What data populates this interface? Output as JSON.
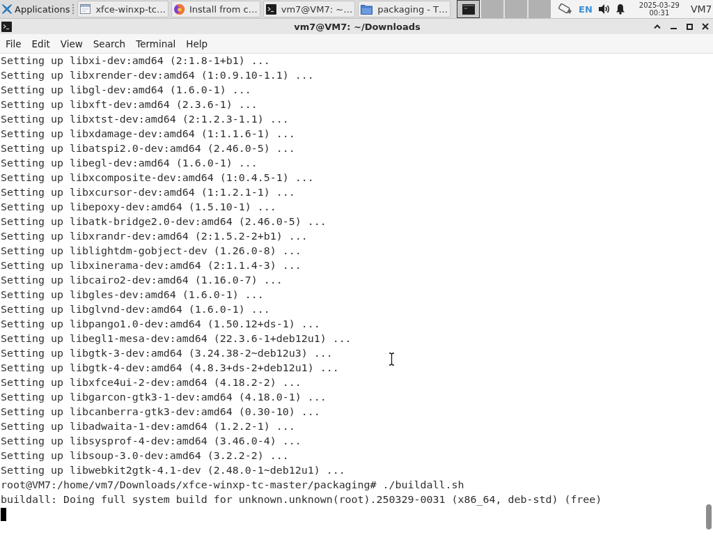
{
  "panel": {
    "applications_menu": {
      "label": "Applications"
    },
    "tasks": [
      {
        "kind": "window",
        "label": "xfce-winxp-tc…"
      },
      {
        "kind": "browser",
        "label": "Install from c…"
      },
      {
        "kind": "terminal",
        "label": "vm7@VM7: ~…"
      },
      {
        "kind": "folder",
        "label": "packaging - T…"
      }
    ],
    "workspaces": [
      {
        "selected": true,
        "window_preview": true
      },
      {
        "selected": false,
        "window_preview": false
      },
      {
        "selected": false,
        "window_preview": false
      },
      {
        "selected": false,
        "window_preview": false
      }
    ],
    "tray": {
      "keyboard_layout": "EN",
      "clock_date": "2025-03-29",
      "clock_time": "00:31",
      "user": "VM7"
    }
  },
  "window": {
    "title": "vm7@VM7: ~/Downloads"
  },
  "menu_bar": [
    "File",
    "Edit",
    "View",
    "Search",
    "Terminal",
    "Help"
  ],
  "terminal": {
    "lines": [
      "Setting up libxi-dev:amd64 (2:1.8-1+b1) ...",
      "Setting up libxrender-dev:amd64 (1:0.9.10-1.1) ...",
      "Setting up libgl-dev:amd64 (1.6.0-1) ...",
      "Setting up libxft-dev:amd64 (2.3.6-1) ...",
      "Setting up libxtst-dev:amd64 (2:1.2.3-1.1) ...",
      "Setting up libxdamage-dev:amd64 (1:1.1.6-1) ...",
      "Setting up libatspi2.0-dev:amd64 (2.46.0-5) ...",
      "Setting up libegl-dev:amd64 (1.6.0-1) ...",
      "Setting up libxcomposite-dev:amd64 (1:0.4.5-1) ...",
      "Setting up libxcursor-dev:amd64 (1:1.2.1-1) ...",
      "Setting up libepoxy-dev:amd64 (1.5.10-1) ...",
      "Setting up libatk-bridge2.0-dev:amd64 (2.46.0-5) ...",
      "Setting up libxrandr-dev:amd64 (2:1.5.2-2+b1) ...",
      "Setting up liblightdm-gobject-dev (1.26.0-8) ...",
      "Setting up libxinerama-dev:amd64 (2:1.1.4-3) ...",
      "Setting up libcairo2-dev:amd64 (1.16.0-7) ...",
      "Setting up libgles-dev:amd64 (1.6.0-1) ...",
      "Setting up libglvnd-dev:amd64 (1.6.0-1) ...",
      "Setting up libpango1.0-dev:amd64 (1.50.12+ds-1) ...",
      "Setting up libegl1-mesa-dev:amd64 (22.3.6-1+deb12u1) ...",
      "Setting up libgtk-3-dev:amd64 (3.24.38-2~deb12u3) ...",
      "Setting up libgtk-4-dev:amd64 (4.8.3+ds-2+deb12u1) ...",
      "Setting up libxfce4ui-2-dev:amd64 (4.18.2-2) ...",
      "Setting up libgarcon-gtk3-1-dev:amd64 (4.18.0-1) ...",
      "Setting up libcanberra-gtk3-dev:amd64 (0.30-10) ...",
      "Setting up libadwaita-1-dev:amd64 (1.2.2-1) ...",
      "Setting up libsysprof-4-dev:amd64 (3.46.0-4) ...",
      "Setting up libsoup-3.0-dev:amd64 (3.2.2-2) ...",
      "Setting up libwebkit2gtk-4.1-dev (2.48.0-1~deb12u1) ...",
      "root@VM7:/home/vm7/Downloads/xfce-winxp-tc-master/packaging# ./buildall.sh",
      "buildall: Doing full system build for unknown.unknown(root).250329-0031 (x86_64, deb-std) (free)"
    ],
    "cursor_visible": true
  }
}
